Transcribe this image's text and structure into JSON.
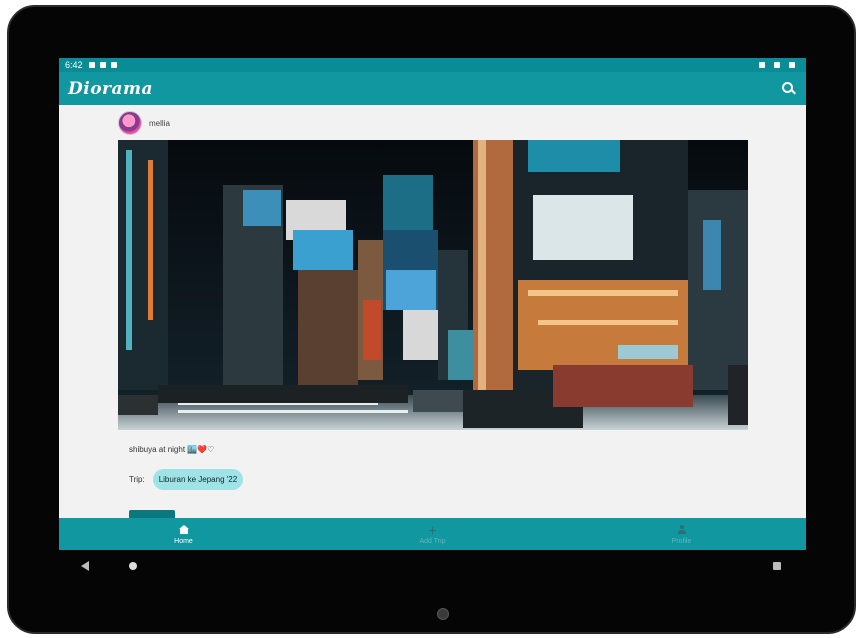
{
  "status_bar": {
    "time": "6:42"
  },
  "app_bar": {
    "title": "Diorama",
    "search_icon": "search-icon"
  },
  "post": {
    "username": "mellia",
    "caption": "shibuya at night 🏙️❤️♡",
    "trip_label": "Trip:",
    "trip_name": "Liburan ke Jepang '22"
  },
  "bottom_nav": {
    "items": [
      {
        "label": "Home",
        "icon": "home-icon"
      },
      {
        "label": "Add Trip",
        "icon": "plus-icon"
      },
      {
        "label": "Profile",
        "icon": "person-icon"
      }
    ]
  },
  "colors": {
    "accent": "#11979f",
    "status_bar": "#0a8c96",
    "chip": "#9fe3e7"
  }
}
